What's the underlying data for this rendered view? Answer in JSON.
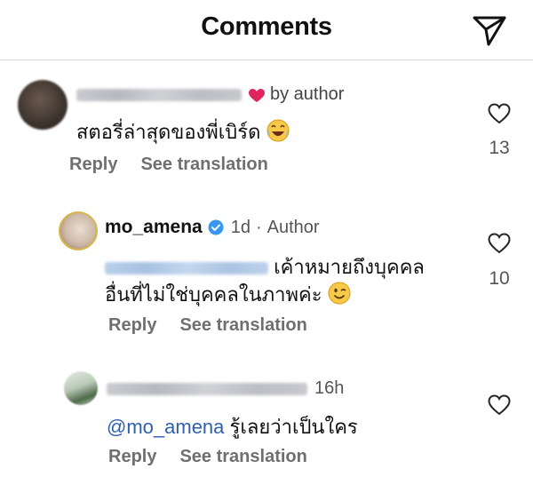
{
  "header": {
    "title": "Comments",
    "send_icon": "send-icon"
  },
  "comments": [
    {
      "username_visible": "",
      "liked_by_author_label": "by author",
      "text": "สตอรี่ล่าสุดของพี่เบิร์ด",
      "emoji": "laughing-emoji",
      "reply_label": "Reply",
      "translate_label": "See translation",
      "like_count": "13"
    },
    {
      "username": "mo_amena",
      "time": "1d",
      "separator": "·",
      "role": "Author",
      "text_line1": "เค้าหมายถึงบุคคล",
      "text_line2": "อื่นที่ไม่ใช่บุคคลในภาพค่ะ",
      "emoji": "winking-emoji",
      "reply_label": "Reply",
      "translate_label": "See translation",
      "like_count": "10"
    },
    {
      "time": "16h",
      "mention": "@mo_amena",
      "text": "รู้เลยว่าเป็นใคร",
      "reply_label": "Reply",
      "translate_label": "See translation",
      "like_count": ""
    }
  ],
  "colors": {
    "heart": "#e0245e",
    "verified": "#3897f0",
    "mention": "#2f5fb0",
    "muted": "#6f6f6f"
  }
}
